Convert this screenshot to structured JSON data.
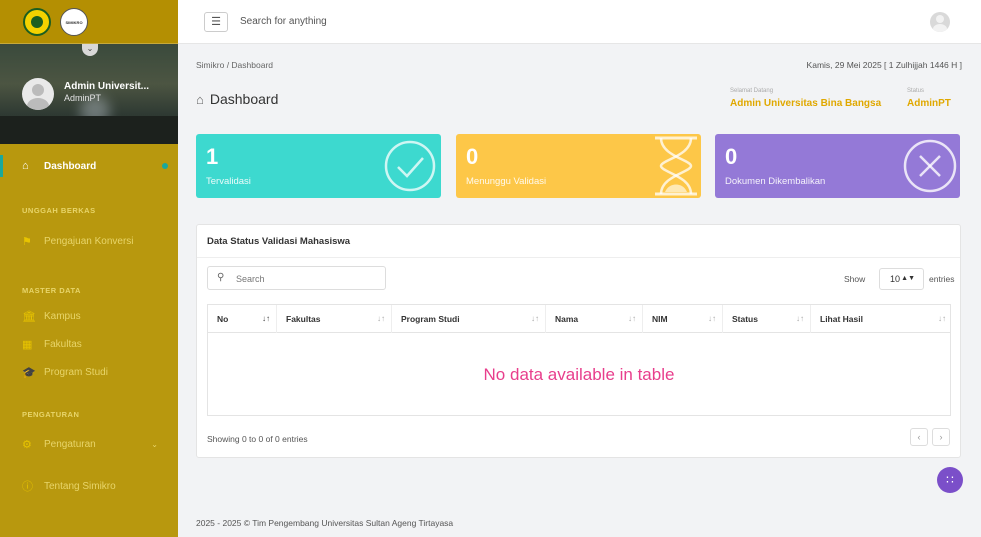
{
  "sidebar": {
    "logo_text": "SIMIKRO",
    "user_name": "Admin Universit...",
    "user_role": "AdminPT",
    "dashboard_label": "Dashboard",
    "section_unggah": "UNGGAH BERKAS",
    "pengajuan_label": "Pengajuan Konversi",
    "section_master": "MASTER DATA",
    "kampus_label": "Kampus",
    "fakultas_label": "Fakultas",
    "prodi_label": "Program Studi",
    "section_pengaturan": "PENGATURAN",
    "pengaturan_label": "Pengaturan",
    "tentang_label": "Tentang Simikro"
  },
  "topbar": {
    "search_placeholder": "Search for anything"
  },
  "header": {
    "breadcrumb": "Simikro  /  Dashboard",
    "date": "Kamis, 29 Mei 2025 [ 1 Zulhijjah 1446 H ]",
    "title": "Dashboard",
    "welcome_label": "Selamat Datang",
    "welcome_value": "Admin Universitas Bina Bangsa",
    "status_label": "Status",
    "status_value": "AdminPT"
  },
  "cards": [
    {
      "number": "1",
      "label": "Tervalidasi",
      "color": "#3dd9cf"
    },
    {
      "number": "0",
      "label": "Menunggu Validasi",
      "color": "#fdc748"
    },
    {
      "number": "0",
      "label": "Dokumen Dikembalikan",
      "color": "#9479d7"
    }
  ],
  "table": {
    "title": "Data Status Validasi Mahasiswa",
    "search_placeholder": "Search",
    "show_label": "Show",
    "show_value": "10",
    "entries_label": "entries",
    "columns": [
      "No",
      "Fakultas",
      "Program Studi",
      "Nama",
      "NIM",
      "Status",
      "Lihat Hasil"
    ],
    "empty_message": "No data available in table",
    "info": "Showing 0 to 0 of 0 entries"
  },
  "footer": "2025 - 2025 © Tim Pengembang Universitas Sultan Ageng Tirtayasa",
  "colors": {
    "sidebar": "#b8980e",
    "accent": "#e0a800",
    "empty_text": "#e83e8c",
    "fab": "#7b4fc9"
  }
}
